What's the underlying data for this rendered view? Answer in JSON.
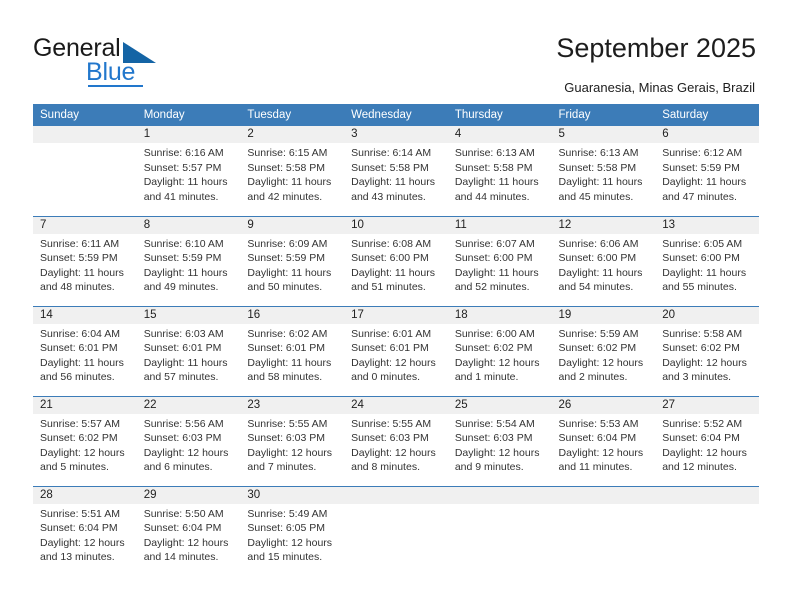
{
  "brand": {
    "name_part1": "General",
    "name_part2": "Blue",
    "triangle_color": "#1464a5",
    "blue_color": "#2277cc"
  },
  "header": {
    "title": "September 2025",
    "subtitle": "Guaranesia, Minas Gerais, Brazil"
  },
  "calendar": {
    "header_bg": "#3c7cb8",
    "daynum_bg": "#f0f0f0",
    "weekdays": [
      "Sunday",
      "Monday",
      "Tuesday",
      "Wednesday",
      "Thursday",
      "Friday",
      "Saturday"
    ],
    "weeks": [
      [
        {
          "day": "",
          "sunrise": "",
          "sunset": "",
          "daylight1": "",
          "daylight2": ""
        },
        {
          "day": "1",
          "sunrise": "Sunrise: 6:16 AM",
          "sunset": "Sunset: 5:57 PM",
          "daylight1": "Daylight: 11 hours",
          "daylight2": "and 41 minutes."
        },
        {
          "day": "2",
          "sunrise": "Sunrise: 6:15 AM",
          "sunset": "Sunset: 5:58 PM",
          "daylight1": "Daylight: 11 hours",
          "daylight2": "and 42 minutes."
        },
        {
          "day": "3",
          "sunrise": "Sunrise: 6:14 AM",
          "sunset": "Sunset: 5:58 PM",
          "daylight1": "Daylight: 11 hours",
          "daylight2": "and 43 minutes."
        },
        {
          "day": "4",
          "sunrise": "Sunrise: 6:13 AM",
          "sunset": "Sunset: 5:58 PM",
          "daylight1": "Daylight: 11 hours",
          "daylight2": "and 44 minutes."
        },
        {
          "day": "5",
          "sunrise": "Sunrise: 6:13 AM",
          "sunset": "Sunset: 5:58 PM",
          "daylight1": "Daylight: 11 hours",
          "daylight2": "and 45 minutes."
        },
        {
          "day": "6",
          "sunrise": "Sunrise: 6:12 AM",
          "sunset": "Sunset: 5:59 PM",
          "daylight1": "Daylight: 11 hours",
          "daylight2": "and 47 minutes."
        }
      ],
      [
        {
          "day": "7",
          "sunrise": "Sunrise: 6:11 AM",
          "sunset": "Sunset: 5:59 PM",
          "daylight1": "Daylight: 11 hours",
          "daylight2": "and 48 minutes."
        },
        {
          "day": "8",
          "sunrise": "Sunrise: 6:10 AM",
          "sunset": "Sunset: 5:59 PM",
          "daylight1": "Daylight: 11 hours",
          "daylight2": "and 49 minutes."
        },
        {
          "day": "9",
          "sunrise": "Sunrise: 6:09 AM",
          "sunset": "Sunset: 5:59 PM",
          "daylight1": "Daylight: 11 hours",
          "daylight2": "and 50 minutes."
        },
        {
          "day": "10",
          "sunrise": "Sunrise: 6:08 AM",
          "sunset": "Sunset: 6:00 PM",
          "daylight1": "Daylight: 11 hours",
          "daylight2": "and 51 minutes."
        },
        {
          "day": "11",
          "sunrise": "Sunrise: 6:07 AM",
          "sunset": "Sunset: 6:00 PM",
          "daylight1": "Daylight: 11 hours",
          "daylight2": "and 52 minutes."
        },
        {
          "day": "12",
          "sunrise": "Sunrise: 6:06 AM",
          "sunset": "Sunset: 6:00 PM",
          "daylight1": "Daylight: 11 hours",
          "daylight2": "and 54 minutes."
        },
        {
          "day": "13",
          "sunrise": "Sunrise: 6:05 AM",
          "sunset": "Sunset: 6:00 PM",
          "daylight1": "Daylight: 11 hours",
          "daylight2": "and 55 minutes."
        }
      ],
      [
        {
          "day": "14",
          "sunrise": "Sunrise: 6:04 AM",
          "sunset": "Sunset: 6:01 PM",
          "daylight1": "Daylight: 11 hours",
          "daylight2": "and 56 minutes."
        },
        {
          "day": "15",
          "sunrise": "Sunrise: 6:03 AM",
          "sunset": "Sunset: 6:01 PM",
          "daylight1": "Daylight: 11 hours",
          "daylight2": "and 57 minutes."
        },
        {
          "day": "16",
          "sunrise": "Sunrise: 6:02 AM",
          "sunset": "Sunset: 6:01 PM",
          "daylight1": "Daylight: 11 hours",
          "daylight2": "and 58 minutes."
        },
        {
          "day": "17",
          "sunrise": "Sunrise: 6:01 AM",
          "sunset": "Sunset: 6:01 PM",
          "daylight1": "Daylight: 12 hours",
          "daylight2": "and 0 minutes."
        },
        {
          "day": "18",
          "sunrise": "Sunrise: 6:00 AM",
          "sunset": "Sunset: 6:02 PM",
          "daylight1": "Daylight: 12 hours",
          "daylight2": "and 1 minute."
        },
        {
          "day": "19",
          "sunrise": "Sunrise: 5:59 AM",
          "sunset": "Sunset: 6:02 PM",
          "daylight1": "Daylight: 12 hours",
          "daylight2": "and 2 minutes."
        },
        {
          "day": "20",
          "sunrise": "Sunrise: 5:58 AM",
          "sunset": "Sunset: 6:02 PM",
          "daylight1": "Daylight: 12 hours",
          "daylight2": "and 3 minutes."
        }
      ],
      [
        {
          "day": "21",
          "sunrise": "Sunrise: 5:57 AM",
          "sunset": "Sunset: 6:02 PM",
          "daylight1": "Daylight: 12 hours",
          "daylight2": "and 5 minutes."
        },
        {
          "day": "22",
          "sunrise": "Sunrise: 5:56 AM",
          "sunset": "Sunset: 6:03 PM",
          "daylight1": "Daylight: 12 hours",
          "daylight2": "and 6 minutes."
        },
        {
          "day": "23",
          "sunrise": "Sunrise: 5:55 AM",
          "sunset": "Sunset: 6:03 PM",
          "daylight1": "Daylight: 12 hours",
          "daylight2": "and 7 minutes."
        },
        {
          "day": "24",
          "sunrise": "Sunrise: 5:55 AM",
          "sunset": "Sunset: 6:03 PM",
          "daylight1": "Daylight: 12 hours",
          "daylight2": "and 8 minutes."
        },
        {
          "day": "25",
          "sunrise": "Sunrise: 5:54 AM",
          "sunset": "Sunset: 6:03 PM",
          "daylight1": "Daylight: 12 hours",
          "daylight2": "and 9 minutes."
        },
        {
          "day": "26",
          "sunrise": "Sunrise: 5:53 AM",
          "sunset": "Sunset: 6:04 PM",
          "daylight1": "Daylight: 12 hours",
          "daylight2": "and 11 minutes."
        },
        {
          "day": "27",
          "sunrise": "Sunrise: 5:52 AM",
          "sunset": "Sunset: 6:04 PM",
          "daylight1": "Daylight: 12 hours",
          "daylight2": "and 12 minutes."
        }
      ],
      [
        {
          "day": "28",
          "sunrise": "Sunrise: 5:51 AM",
          "sunset": "Sunset: 6:04 PM",
          "daylight1": "Daylight: 12 hours",
          "daylight2": "and 13 minutes."
        },
        {
          "day": "29",
          "sunrise": "Sunrise: 5:50 AM",
          "sunset": "Sunset: 6:04 PM",
          "daylight1": "Daylight: 12 hours",
          "daylight2": "and 14 minutes."
        },
        {
          "day": "30",
          "sunrise": "Sunrise: 5:49 AM",
          "sunset": "Sunset: 6:05 PM",
          "daylight1": "Daylight: 12 hours",
          "daylight2": "and 15 minutes."
        },
        {
          "day": "",
          "sunrise": "",
          "sunset": "",
          "daylight1": "",
          "daylight2": ""
        },
        {
          "day": "",
          "sunrise": "",
          "sunset": "",
          "daylight1": "",
          "daylight2": ""
        },
        {
          "day": "",
          "sunrise": "",
          "sunset": "",
          "daylight1": "",
          "daylight2": ""
        },
        {
          "day": "",
          "sunrise": "",
          "sunset": "",
          "daylight1": "",
          "daylight2": ""
        }
      ]
    ]
  }
}
